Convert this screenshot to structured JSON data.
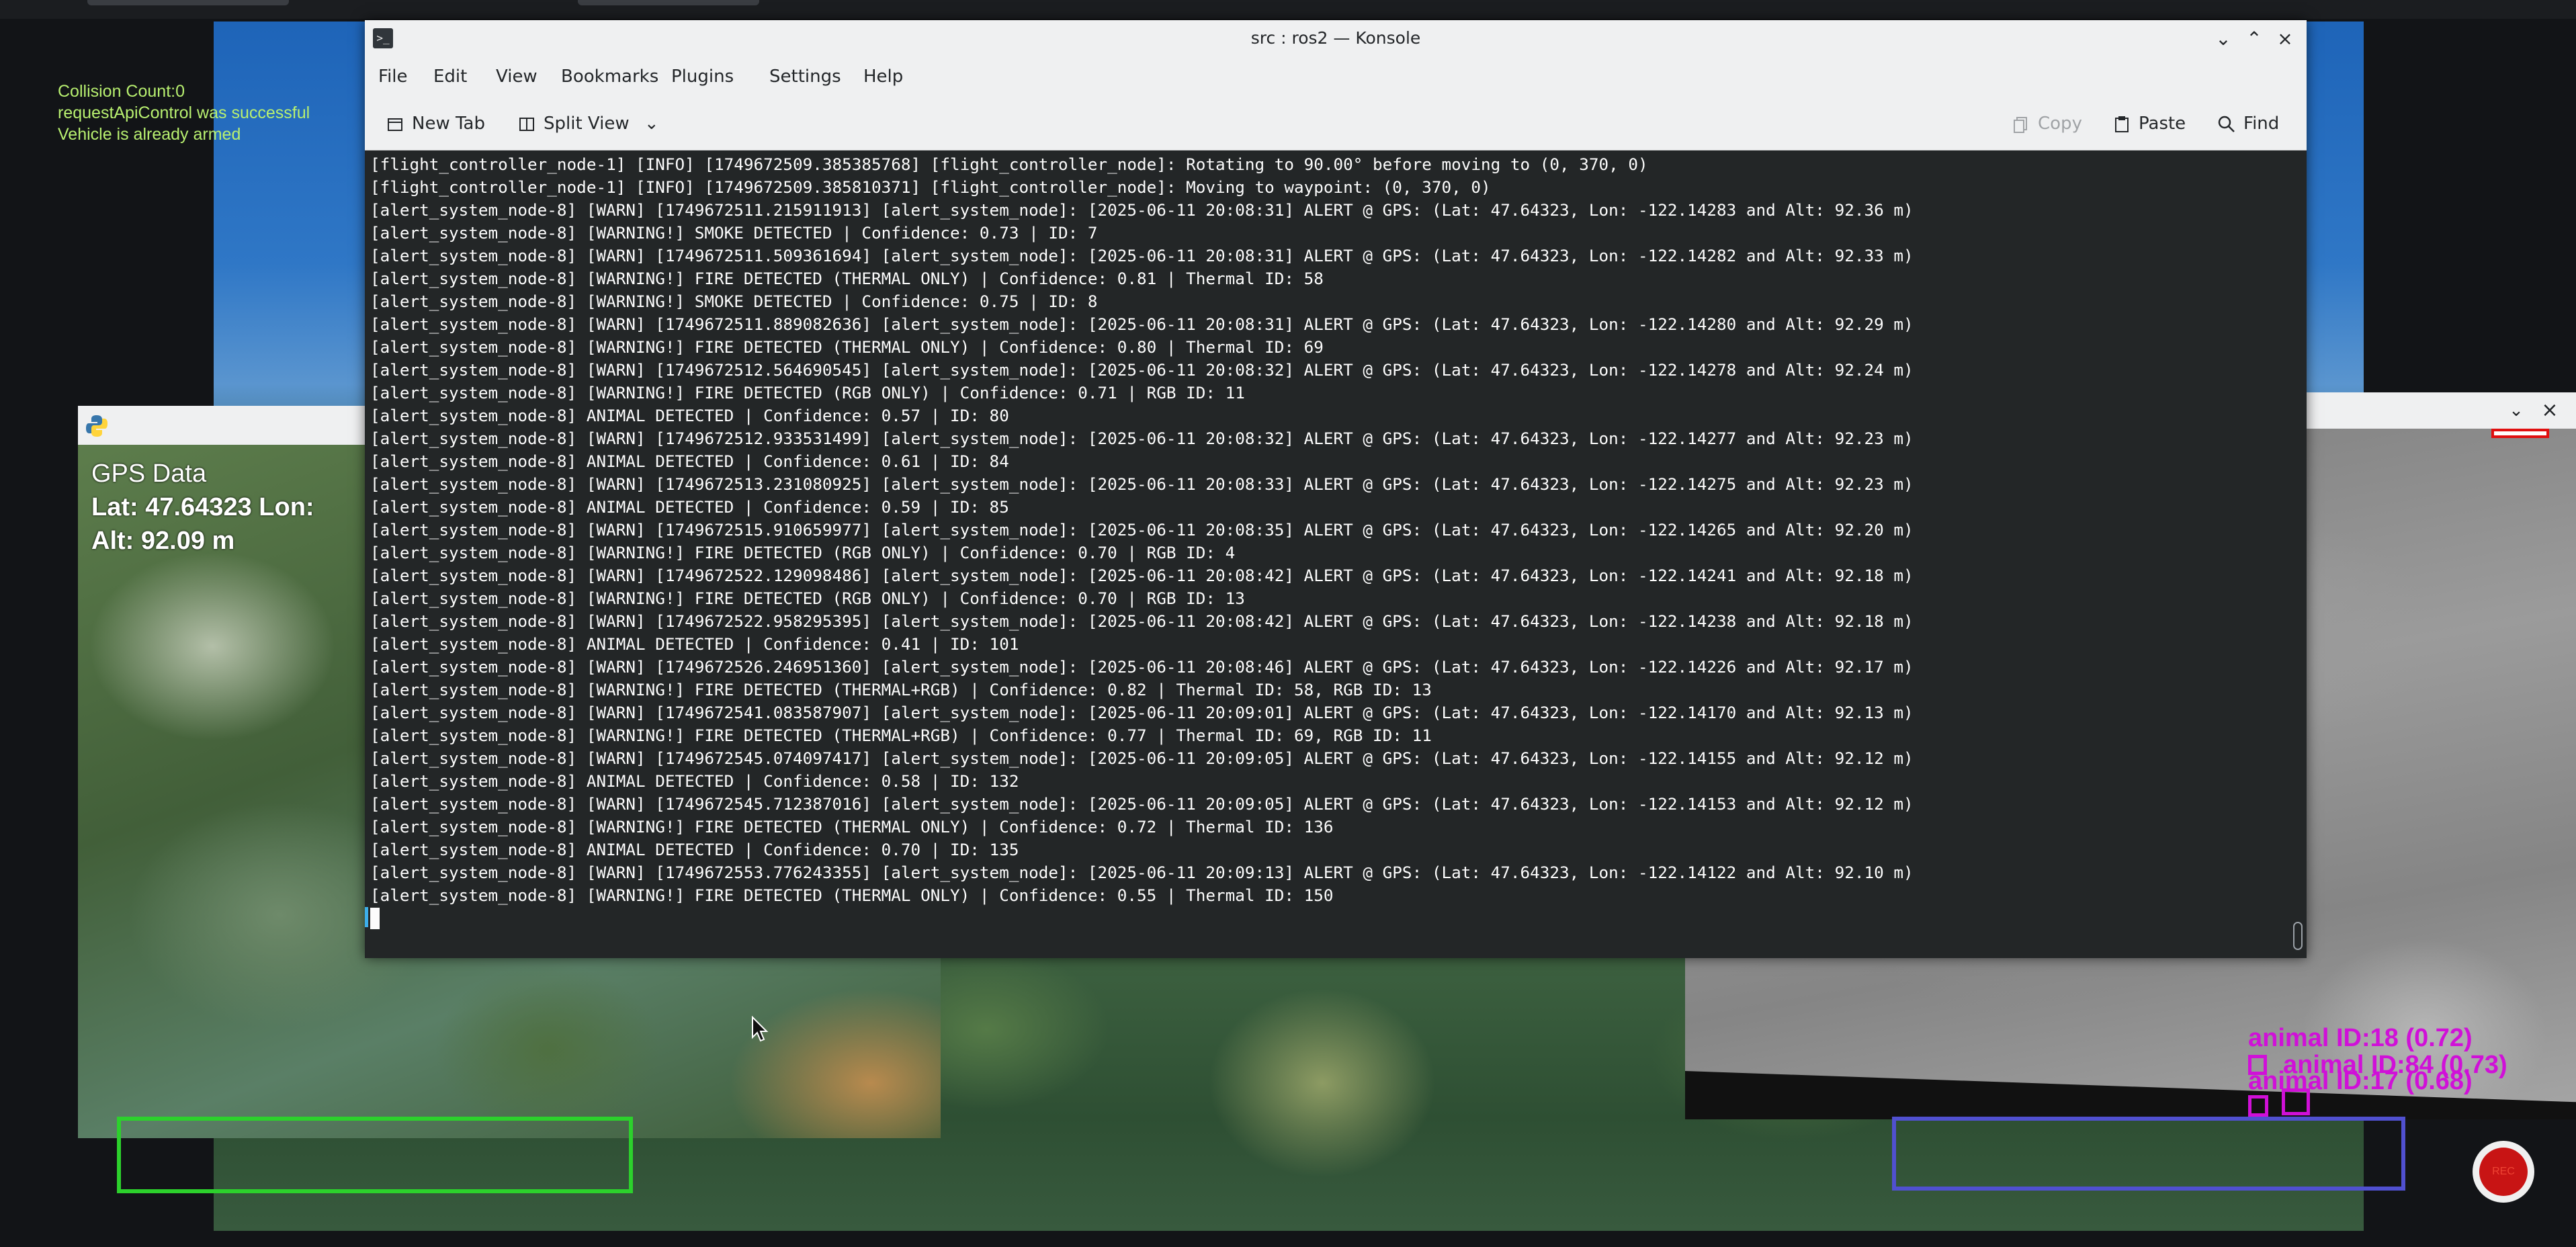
{
  "simulator": {
    "hud_lines": [
      "Collision Count:0",
      "requestApiControl was successful",
      "Vehicle is already armed"
    ]
  },
  "gps_window": {
    "title_icon": "python-icon",
    "overlay": {
      "title": "GPS Data",
      "lat_line": "Lat: 47.64323  Lon:",
      "alt_line": "Alt: 92.09 m"
    }
  },
  "thermal_window": {
    "detections": [
      "animal ID:18 (0.72)",
      "animal ID:84 (0.73)",
      "animal ID:17 (0.68)"
    ],
    "detection_color": "#d010d8"
  },
  "record_button": {
    "label": "REC"
  },
  "konsole": {
    "title": "src : ros2 — Konsole",
    "menu": [
      "File",
      "Edit",
      "View",
      "Bookmarks",
      "Plugins",
      "Settings",
      "Help"
    ],
    "toolbar": {
      "new_tab": "New Tab",
      "split_view": "Split View",
      "copy": "Copy",
      "paste": "Paste",
      "find": "Find"
    },
    "lines": [
      "[flight_controller_node-1] [INFO] [1749672509.385385768] [flight_controller_node]: Rotating to 90.00° before moving to (0, 370, 0)",
      "[flight_controller_node-1] [INFO] [1749672509.385810371] [flight_controller_node]: Moving to waypoint: (0, 370, 0)",
      "[alert_system_node-8] [WARN] [1749672511.215911913] [alert_system_node]: [2025-06-11 20:08:31] ALERT @ GPS: (Lat: 47.64323, Lon: -122.14283 and Alt: 92.36 m)",
      "[alert_system_node-8] [WARNING!] SMOKE DETECTED | Confidence: 0.73 | ID: 7",
      "[alert_system_node-8] [WARN] [1749672511.509361694] [alert_system_node]: [2025-06-11 20:08:31] ALERT @ GPS: (Lat: 47.64323, Lon: -122.14282 and Alt: 92.33 m)",
      "[alert_system_node-8] [WARNING!] FIRE DETECTED (THERMAL ONLY) | Confidence: 0.81 | Thermal ID: 58",
      "[alert_system_node-8] [WARNING!] SMOKE DETECTED | Confidence: 0.75 | ID: 8",
      "[alert_system_node-8] [WARN] [1749672511.889082636] [alert_system_node]: [2025-06-11 20:08:31] ALERT @ GPS: (Lat: 47.64323, Lon: -122.14280 and Alt: 92.29 m)",
      "[alert_system_node-8] [WARNING!] FIRE DETECTED (THERMAL ONLY) | Confidence: 0.80 | Thermal ID: 69",
      "[alert_system_node-8] [WARN] [1749672512.564690545] [alert_system_node]: [2025-06-11 20:08:32] ALERT @ GPS: (Lat: 47.64323, Lon: -122.14278 and Alt: 92.24 m)",
      "[alert_system_node-8] [WARNING!] FIRE DETECTED (RGB ONLY) | Confidence: 0.71 | RGB ID: 11",
      "[alert_system_node-8] ANIMAL DETECTED | Confidence: 0.57 | ID: 80",
      "[alert_system_node-8] [WARN] [1749672512.933531499] [alert_system_node]: [2025-06-11 20:08:32] ALERT @ GPS: (Lat: 47.64323, Lon: -122.14277 and Alt: 92.23 m)",
      "[alert_system_node-8] ANIMAL DETECTED | Confidence: 0.61 | ID: 84",
      "[alert_system_node-8] [WARN] [1749672513.231080925] [alert_system_node]: [2025-06-11 20:08:33] ALERT @ GPS: (Lat: 47.64323, Lon: -122.14275 and Alt: 92.23 m)",
      "[alert_system_node-8] ANIMAL DETECTED | Confidence: 0.59 | ID: 85",
      "[alert_system_node-8] [WARN] [1749672515.910659977] [alert_system_node]: [2025-06-11 20:08:35] ALERT @ GPS: (Lat: 47.64323, Lon: -122.14265 and Alt: 92.20 m)",
      "[alert_system_node-8] [WARNING!] FIRE DETECTED (RGB ONLY) | Confidence: 0.70 | RGB ID: 4",
      "[alert_system_node-8] [WARN] [1749672522.129098486] [alert_system_node]: [2025-06-11 20:08:42] ALERT @ GPS: (Lat: 47.64323, Lon: -122.14241 and Alt: 92.18 m)",
      "[alert_system_node-8] [WARNING!] FIRE DETECTED (RGB ONLY) | Confidence: 0.70 | RGB ID: 13",
      "[alert_system_node-8] [WARN] [1749672522.958295395] [alert_system_node]: [2025-06-11 20:08:42] ALERT @ GPS: (Lat: 47.64323, Lon: -122.14238 and Alt: 92.18 m)",
      "[alert_system_node-8] ANIMAL DETECTED | Confidence: 0.41 | ID: 101",
      "[alert_system_node-8] [WARN] [1749672526.246951360] [alert_system_node]: [2025-06-11 20:08:46] ALERT @ GPS: (Lat: 47.64323, Lon: -122.14226 and Alt: 92.17 m)",
      "[alert_system_node-8] [WARNING!] FIRE DETECTED (THERMAL+RGB) | Confidence: 0.82 | Thermal ID: 58, RGB ID: 13",
      "[alert_system_node-8] [WARN] [1749672541.083587907] [alert_system_node]: [2025-06-11 20:09:01] ALERT @ GPS: (Lat: 47.64323, Lon: -122.14170 and Alt: 92.13 m)",
      "[alert_system_node-8] [WARNING!] FIRE DETECTED (THERMAL+RGB) | Confidence: 0.77 | Thermal ID: 69, RGB ID: 11",
      "[alert_system_node-8] [WARN] [1749672545.074097417] [alert_system_node]: [2025-06-11 20:09:05] ALERT @ GPS: (Lat: 47.64323, Lon: -122.14155 and Alt: 92.12 m)",
      "[alert_system_node-8] ANIMAL DETECTED | Confidence: 0.58 | ID: 132",
      "[alert_system_node-8] [WARN] [1749672545.712387016] [alert_system_node]: [2025-06-11 20:09:05] ALERT @ GPS: (Lat: 47.64323, Lon: -122.14153 and Alt: 92.12 m)",
      "[alert_system_node-8] [WARNING!] FIRE DETECTED (THERMAL ONLY) | Confidence: 0.72 | Thermal ID: 136",
      "[alert_system_node-8] ANIMAL DETECTED | Confidence: 0.70 | ID: 135",
      "[alert_system_node-8] [WARN] [1749672553.776243355] [alert_system_node]: [2025-06-11 20:09:13] ALERT @ GPS: (Lat: 47.64323, Lon: -122.14122 and Alt: 92.10 m)",
      "[alert_system_node-8] [WARNING!] FIRE DETECTED (THERMAL ONLY) | Confidence: 0.55 | Thermal ID: 150"
    ]
  }
}
